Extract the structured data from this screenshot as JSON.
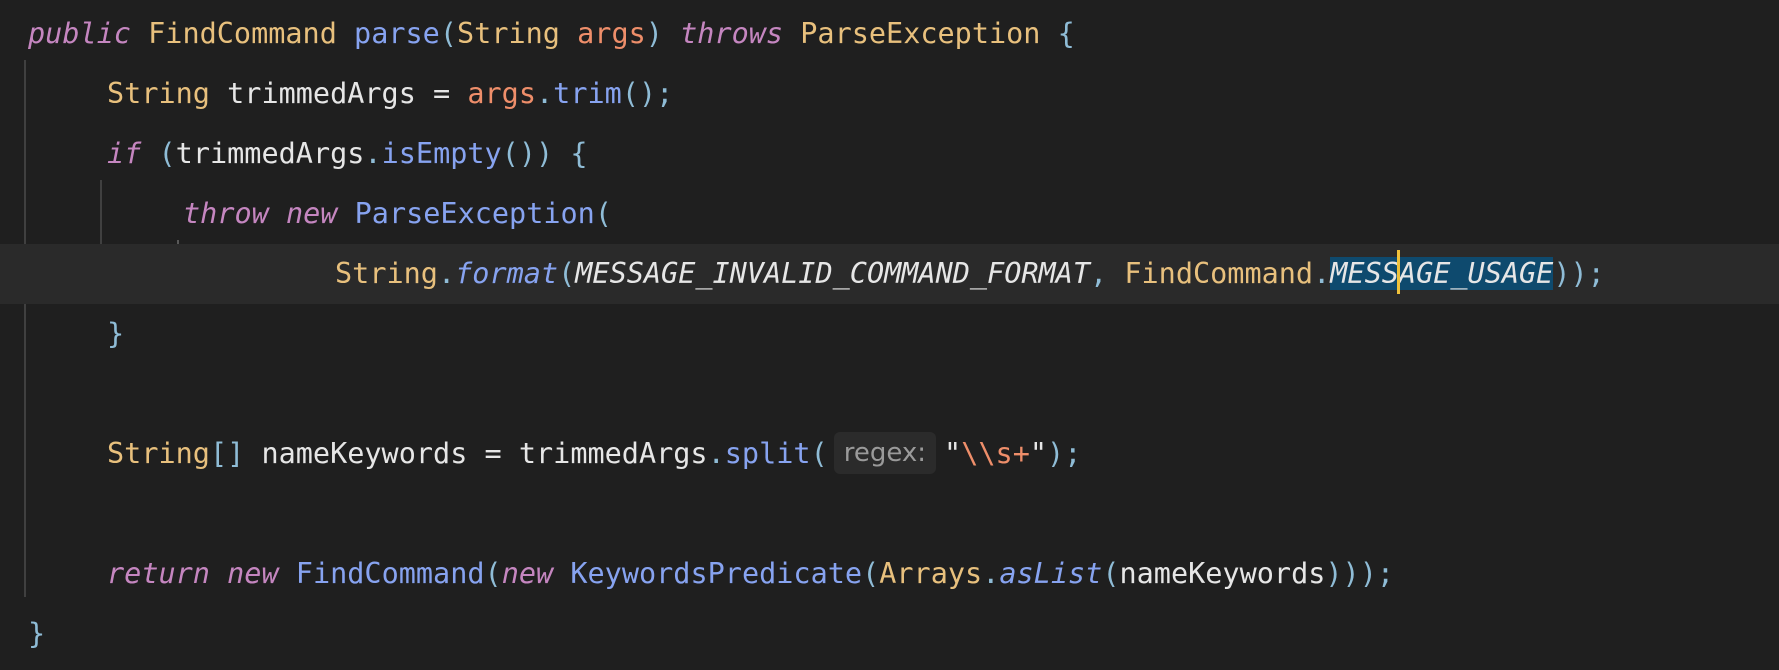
{
  "editor": {
    "lines": [
      {
        "tokens": [
          {
            "t": "public",
            "c": "kw"
          },
          {
            "t": " ",
            "c": "plain"
          },
          {
            "t": "FindCommand",
            "c": "type"
          },
          {
            "t": " ",
            "c": "plain"
          },
          {
            "t": "parse",
            "c": "fn"
          },
          {
            "t": "(",
            "c": "punc"
          },
          {
            "t": "String",
            "c": "type"
          },
          {
            "t": " ",
            "c": "plain"
          },
          {
            "t": "args",
            "c": "param"
          },
          {
            "t": ")",
            "c": "punc"
          },
          {
            "t": " ",
            "c": "plain"
          },
          {
            "t": "throws",
            "c": "kw"
          },
          {
            "t": " ",
            "c": "plain"
          },
          {
            "t": "ParseException",
            "c": "type"
          },
          {
            "t": " ",
            "c": "plain"
          },
          {
            "t": "{",
            "c": "punc"
          }
        ]
      },
      {
        "tokens": [
          {
            "t": "String",
            "c": "type"
          },
          {
            "t": " ",
            "c": "plain"
          },
          {
            "t": "trimmedArgs",
            "c": "plain"
          },
          {
            "t": " = ",
            "c": "op"
          },
          {
            "t": "args",
            "c": "param"
          },
          {
            "t": ".",
            "c": "punc"
          },
          {
            "t": "trim",
            "c": "fn"
          },
          {
            "t": "();",
            "c": "punc"
          }
        ]
      },
      {
        "tokens": [
          {
            "t": "if",
            "c": "kw"
          },
          {
            "t": " ",
            "c": "plain"
          },
          {
            "t": "(",
            "c": "punc"
          },
          {
            "t": "trimmedArgs",
            "c": "plain"
          },
          {
            "t": ".",
            "c": "punc"
          },
          {
            "t": "isEmpty",
            "c": "fn"
          },
          {
            "t": "()) {",
            "c": "punc"
          }
        ]
      },
      {
        "tokens": [
          {
            "t": "throw",
            "c": "kw"
          },
          {
            "t": " ",
            "c": "plain"
          },
          {
            "t": "new",
            "c": "kw"
          },
          {
            "t": " ",
            "c": "plain"
          },
          {
            "t": "ParseException",
            "c": "fn"
          },
          {
            "t": "(",
            "c": "punc"
          }
        ]
      },
      {
        "tokens": [
          {
            "t": "String",
            "c": "type"
          },
          {
            "t": ".",
            "c": "punc"
          },
          {
            "t": "format",
            "c": "fn-it"
          },
          {
            "t": "(",
            "c": "punc"
          },
          {
            "t": "MESSAGE_INVALID_COMMAND_FORMAT",
            "c": "const"
          },
          {
            "t": ", ",
            "c": "punc"
          },
          {
            "t": "FindCommand",
            "c": "type"
          },
          {
            "t": ".",
            "c": "punc"
          },
          {
            "t": "MESS",
            "c": "sel"
          },
          {
            "t": "",
            "c": "cursor"
          },
          {
            "t": "AGE_USAGE",
            "c": "sel"
          },
          {
            "t": "));",
            "c": "punc"
          }
        ]
      },
      {
        "tokens": [
          {
            "t": "}",
            "c": "punc"
          }
        ]
      },
      {
        "tokens": [
          {
            "t": "String",
            "c": "type"
          },
          {
            "t": "[]",
            "c": "punc"
          },
          {
            "t": " ",
            "c": "plain"
          },
          {
            "t": "nameKeywords",
            "c": "plain"
          },
          {
            "t": " = ",
            "c": "op"
          },
          {
            "t": "trimmedArgs",
            "c": "plain"
          },
          {
            "t": ".",
            "c": "punc"
          },
          {
            "t": "split",
            "c": "fn"
          },
          {
            "t": "(",
            "c": "punc"
          },
          {
            "t": "regex:",
            "c": "inlay"
          },
          {
            "t": "\"",
            "c": "plain"
          },
          {
            "t": "\\\\s+",
            "c": "esc"
          },
          {
            "t": "\"",
            "c": "plain"
          },
          {
            "t": ");",
            "c": "punc"
          }
        ]
      },
      {
        "tokens": [
          {
            "t": "return",
            "c": "kw"
          },
          {
            "t": " ",
            "c": "plain"
          },
          {
            "t": "new",
            "c": "kw"
          },
          {
            "t": " ",
            "c": "plain"
          },
          {
            "t": "FindCommand",
            "c": "fn"
          },
          {
            "t": "(",
            "c": "punc"
          },
          {
            "t": "new",
            "c": "kw"
          },
          {
            "t": " ",
            "c": "plain"
          },
          {
            "t": "KeywordsPredicate",
            "c": "fn"
          },
          {
            "t": "(",
            "c": "punc"
          },
          {
            "t": "Arrays",
            "c": "type"
          },
          {
            "t": ".",
            "c": "punc"
          },
          {
            "t": "asList",
            "c": "fn-it"
          },
          {
            "t": "(",
            "c": "punc"
          },
          {
            "t": "nameKeywords",
            "c": "plain"
          },
          {
            "t": ")));",
            "c": "punc"
          }
        ]
      },
      {
        "tokens": [
          {
            "t": "}",
            "c": "punc"
          }
        ]
      }
    ]
  },
  "colors": {
    "background": "#1f1f1f",
    "current_line": "#2a2a2a",
    "selection": "#0e4a6e",
    "cursor": "#f0c23b"
  }
}
